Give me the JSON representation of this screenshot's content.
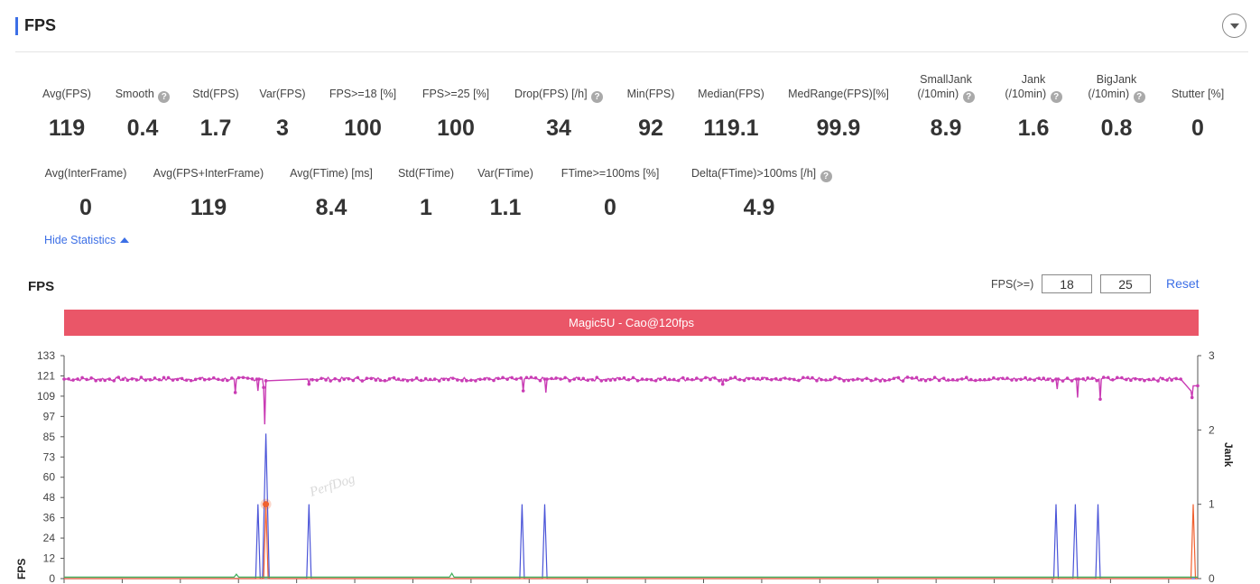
{
  "header": {
    "title": "FPS"
  },
  "stats_row1": [
    {
      "label": "Avg(FPS)",
      "value": "119",
      "help": false
    },
    {
      "label": "Smooth",
      "value": "0.4",
      "help": true
    },
    {
      "label": "Std(FPS)",
      "value": "1.7",
      "help": false
    },
    {
      "label": "Var(FPS)",
      "value": "3",
      "help": false
    },
    {
      "label": "FPS>=18 [%]",
      "value": "100",
      "help": false
    },
    {
      "label": "FPS>=25 [%]",
      "value": "100",
      "help": false
    },
    {
      "label": "Drop(FPS) [/h]",
      "value": "34",
      "help": true
    },
    {
      "label": "Min(FPS)",
      "value": "92",
      "help": false
    },
    {
      "label": "Median(FPS)",
      "value": "119.1",
      "help": false
    },
    {
      "label": "MedRange(FPS)[%]",
      "value": "99.9",
      "help": false
    },
    {
      "label": "SmallJank",
      "label2": "(/10min)",
      "value": "8.9",
      "help": true
    },
    {
      "label": "Jank",
      "label2": "(/10min)",
      "value": "1.6",
      "help": true
    },
    {
      "label": "BigJank",
      "label2": "(/10min)",
      "value": "0.8",
      "help": true
    },
    {
      "label": "Stutter [%]",
      "value": "0",
      "help": false
    }
  ],
  "stats_row2": [
    {
      "label": "Avg(InterFrame)",
      "value": "0",
      "help": false
    },
    {
      "label": "Avg(FPS+InterFrame)",
      "value": "119",
      "help": false
    },
    {
      "label": "Avg(FTime) [ms]",
      "value": "8.4",
      "help": false
    },
    {
      "label": "Std(FTime)",
      "value": "1",
      "help": false
    },
    {
      "label": "Var(FTime)",
      "value": "1.1",
      "help": false
    },
    {
      "label": "FTime>=100ms [%]",
      "value": "0",
      "help": false
    },
    {
      "label": "Delta(FTime)>100ms [/h]",
      "value": "4.9",
      "help": true
    }
  ],
  "help_glyph": "?",
  "hide_statistics": "Hide Statistics",
  "chart_section": {
    "title": "FPS",
    "filter_label": "FPS(>=)",
    "filter_values": [
      "18",
      "25"
    ],
    "reset": "Reset",
    "banner": "Magic5U - Cao@120fps",
    "watermark": "PerfDog"
  },
  "colors": {
    "accent": "#3c6fe6",
    "banner": "#ea5668",
    "fps_line": "#c93cb4",
    "jank_line": "#4b55d8",
    "bigjank_line": "#f0602f",
    "interframe_line": "#3fae5a"
  },
  "chart_data": {
    "type": "line",
    "title": "",
    "ylabel": "FPS",
    "y2label": "Jank",
    "yticks": [
      "133",
      "121",
      "109",
      "97",
      "85",
      "73",
      "60",
      "48",
      "36",
      "24",
      "12",
      "0"
    ],
    "y2ticks": [
      "3",
      "2",
      "1",
      "0"
    ],
    "ylim": [
      0,
      133
    ],
    "y2lim": [
      0,
      3
    ],
    "xlim": [
      0,
      1000
    ],
    "grid": false,
    "series": [
      {
        "name": "FPS",
        "axis": "left",
        "baseline": 119,
        "values_at": [
          [
            0,
            119
          ],
          [
            150,
            119
          ],
          [
            151,
            111
          ],
          [
            152,
            119
          ],
          [
            170,
            119
          ],
          [
            171,
            112
          ],
          [
            172,
            119
          ],
          [
            175,
            119
          ],
          [
            176,
            114
          ],
          [
            177,
            92
          ],
          [
            178,
            118
          ],
          [
            215,
            119
          ],
          [
            216,
            116
          ],
          [
            217,
            119
          ],
          [
            404,
            119
          ],
          [
            405,
            112
          ],
          [
            406,
            119
          ],
          [
            424,
            119
          ],
          [
            425,
            111
          ],
          [
            426,
            119
          ],
          [
            580,
            119
          ],
          [
            581,
            116
          ],
          [
            582,
            119
          ],
          [
            875,
            119
          ],
          [
            876,
            113
          ],
          [
            877,
            119
          ],
          [
            893,
            119
          ],
          [
            894,
            108
          ],
          [
            895,
            119
          ],
          [
            913,
            119
          ],
          [
            914,
            107
          ],
          [
            915,
            119
          ],
          [
            985,
            119
          ],
          [
            994,
            112
          ],
          [
            995,
            108
          ],
          [
            996,
            115
          ],
          [
            1000,
            115
          ]
        ]
      },
      {
        "name": "Jank",
        "axis": "right",
        "values_at": [
          [
            0,
            0
          ],
          [
            169,
            0
          ],
          [
            171,
            1
          ],
          [
            173,
            0
          ],
          [
            175,
            0
          ],
          [
            178,
            1.95
          ],
          [
            181,
            0
          ],
          [
            214,
            0
          ],
          [
            216,
            1
          ],
          [
            218,
            0
          ],
          [
            402,
            0
          ],
          [
            404,
            1
          ],
          [
            406,
            0
          ],
          [
            422,
            0
          ],
          [
            424,
            1
          ],
          [
            426,
            0
          ],
          [
            873,
            0
          ],
          [
            875,
            1
          ],
          [
            877,
            0
          ],
          [
            890,
            0
          ],
          [
            892,
            1
          ],
          [
            894,
            0
          ],
          [
            910,
            0
          ],
          [
            912,
            1
          ],
          [
            914,
            0
          ],
          [
            1000,
            0
          ]
        ]
      },
      {
        "name": "BigJank",
        "axis": "right",
        "values_at": [
          [
            0,
            0
          ],
          [
            176,
            0
          ],
          [
            178,
            1
          ],
          [
            180,
            0
          ],
          [
            994,
            0
          ],
          [
            996,
            1
          ],
          [
            998,
            0
          ],
          [
            1000,
            0
          ]
        ]
      },
      {
        "name": "InterFrame",
        "axis": "right",
        "values_at": [
          [
            0,
            0.02
          ],
          [
            150,
            0.02
          ],
          [
            152,
            0.06
          ],
          [
            154,
            0.02
          ],
          [
            340,
            0.02
          ],
          [
            342,
            0.07
          ],
          [
            344,
            0.02
          ],
          [
            1000,
            0.02
          ]
        ]
      }
    ]
  }
}
